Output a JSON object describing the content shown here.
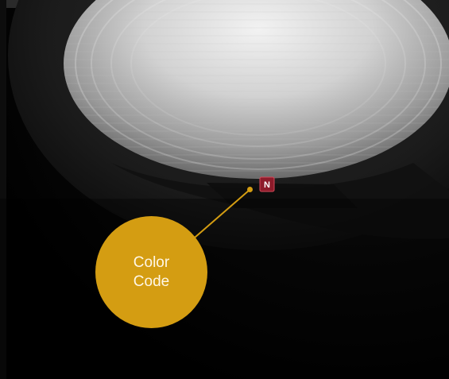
{
  "photo": {
    "subject": "lens-with-color-code-badge",
    "badge_letter": "N"
  },
  "callout": {
    "label": "Color Code",
    "color": "#d49d12"
  }
}
